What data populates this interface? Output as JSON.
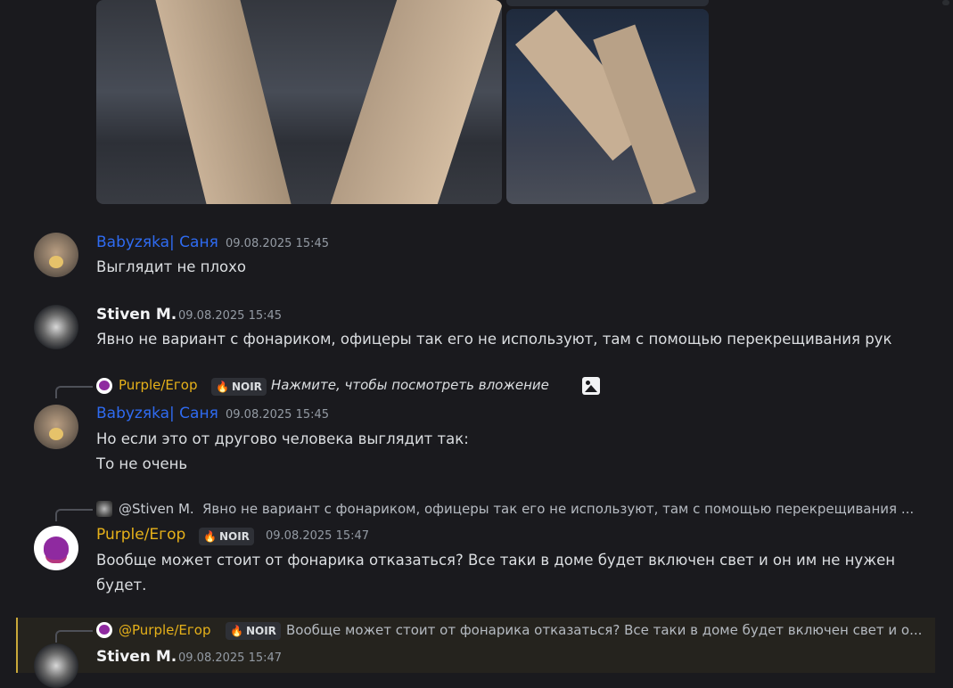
{
  "attachments": {
    "image1_name": "image-attachment-1",
    "image2_name": "image-attachment-2"
  },
  "messages": [
    {
      "author": "Babyzяka| Саня",
      "timestamp": "09.08.2025 15:45",
      "lines": [
        "Выглядит не плохо"
      ],
      "name_color": "#2f6bf1"
    },
    {
      "author": "Stiven M.",
      "timestamp": "09.08.2025 15:45",
      "lines": [
        "Явно не вариант с фонариком, офицеры так его не используют, там с помощью перекрещивания рук"
      ],
      "name_color": "#f2f3f5"
    },
    {
      "reply": {
        "author": "Purple/Егор",
        "tag": "NOIR",
        "text": "Нажмите, чтобы посмотреть вложение",
        "icon": "image-icon"
      },
      "author": "Babyzяka| Саня",
      "timestamp": "09.08.2025 15:45",
      "lines": [
        "Но если это от другово человека выглядит так:",
        "То не очень"
      ],
      "name_color": "#2f6bf1"
    },
    {
      "reply": {
        "author": "@Stiven M.",
        "text": "Явно не вариант с фонариком, офицеры так его не используют, там с помощью перекрещивания ..."
      },
      "author": "Purple/Егор",
      "tag": "NOIR",
      "timestamp": "09.08.2025 15:47",
      "lines": [
        "Вообще может стоит от фонарика отказаться? Все таки в доме будет включен свет и он им не нужен",
        "будет."
      ],
      "name_color": "#e6b11a"
    },
    {
      "reply": {
        "author": "@Purple/Егор",
        "tag": "NOIR",
        "text": "Вообще может стоит от фонарика отказаться? Все таки в доме будет включен свет и о..."
      },
      "author": "Stiven M.",
      "timestamp": "09.08.2025 15:47",
      "lines": [],
      "name_color": "#f2f3f5"
    }
  ],
  "colors": {
    "background": "#1a1a1e",
    "mention_highlight": "#25231e",
    "highlight_bar": "#c9a83a"
  }
}
